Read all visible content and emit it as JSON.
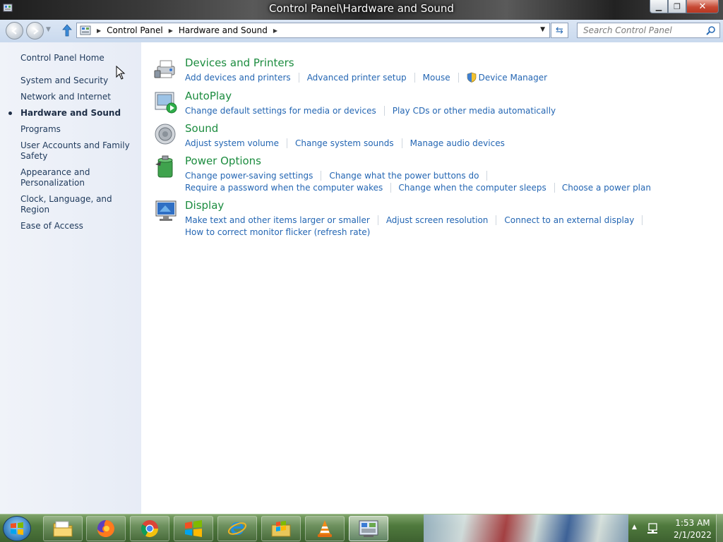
{
  "window": {
    "title": "Control Panel\\Hardware and Sound"
  },
  "address": {
    "crumbs": [
      "Control Panel",
      "Hardware and Sound"
    ]
  },
  "search": {
    "placeholder": "Search Control Panel"
  },
  "sidebar": {
    "home": "Control Panel Home",
    "items": [
      {
        "label": "System and Security",
        "active": false
      },
      {
        "label": "Network and Internet",
        "active": false
      },
      {
        "label": "Hardware and Sound",
        "active": true
      },
      {
        "label": "Programs",
        "active": false
      },
      {
        "label": "User Accounts and Family Safety",
        "active": false
      },
      {
        "label": "Appearance and Personalization",
        "active": false
      },
      {
        "label": "Clock, Language, and Region",
        "active": false
      },
      {
        "label": "Ease of Access",
        "active": false
      }
    ]
  },
  "categories": [
    {
      "title": "Devices and Printers",
      "icon": "printer-icon",
      "rows": [
        [
          "Add devices and printers",
          "Advanced printer setup",
          "Mouse",
          "Device Manager"
        ]
      ]
    },
    {
      "title": "AutoPlay",
      "icon": "autoplay-icon",
      "rows": [
        [
          "Change default settings for media or devices",
          "Play CDs or other media automatically"
        ]
      ]
    },
    {
      "title": "Sound",
      "icon": "speaker-icon",
      "rows": [
        [
          "Adjust system volume",
          "Change system sounds",
          "Manage audio devices"
        ]
      ]
    },
    {
      "title": "Power Options",
      "icon": "battery-icon",
      "rows": [
        [
          "Change power-saving settings",
          "Change what the power buttons do"
        ],
        [
          "Require a password when the computer wakes",
          "Change when the computer sleeps",
          "Choose a power plan"
        ]
      ]
    },
    {
      "title": "Display",
      "icon": "monitor-icon",
      "rows": [
        [
          "Make text and other items larger or smaller",
          "Adjust screen resolution",
          "Connect to an external display"
        ],
        [
          "How to correct monitor flicker (refresh rate)"
        ]
      ]
    }
  ],
  "taskbar": {
    "clock_time": "1:53 AM",
    "clock_date": "2/1/2022"
  },
  "colors": {
    "category_title": "#1c8c3f",
    "link": "#2466b3",
    "sidebar_text": "#1e395b"
  }
}
